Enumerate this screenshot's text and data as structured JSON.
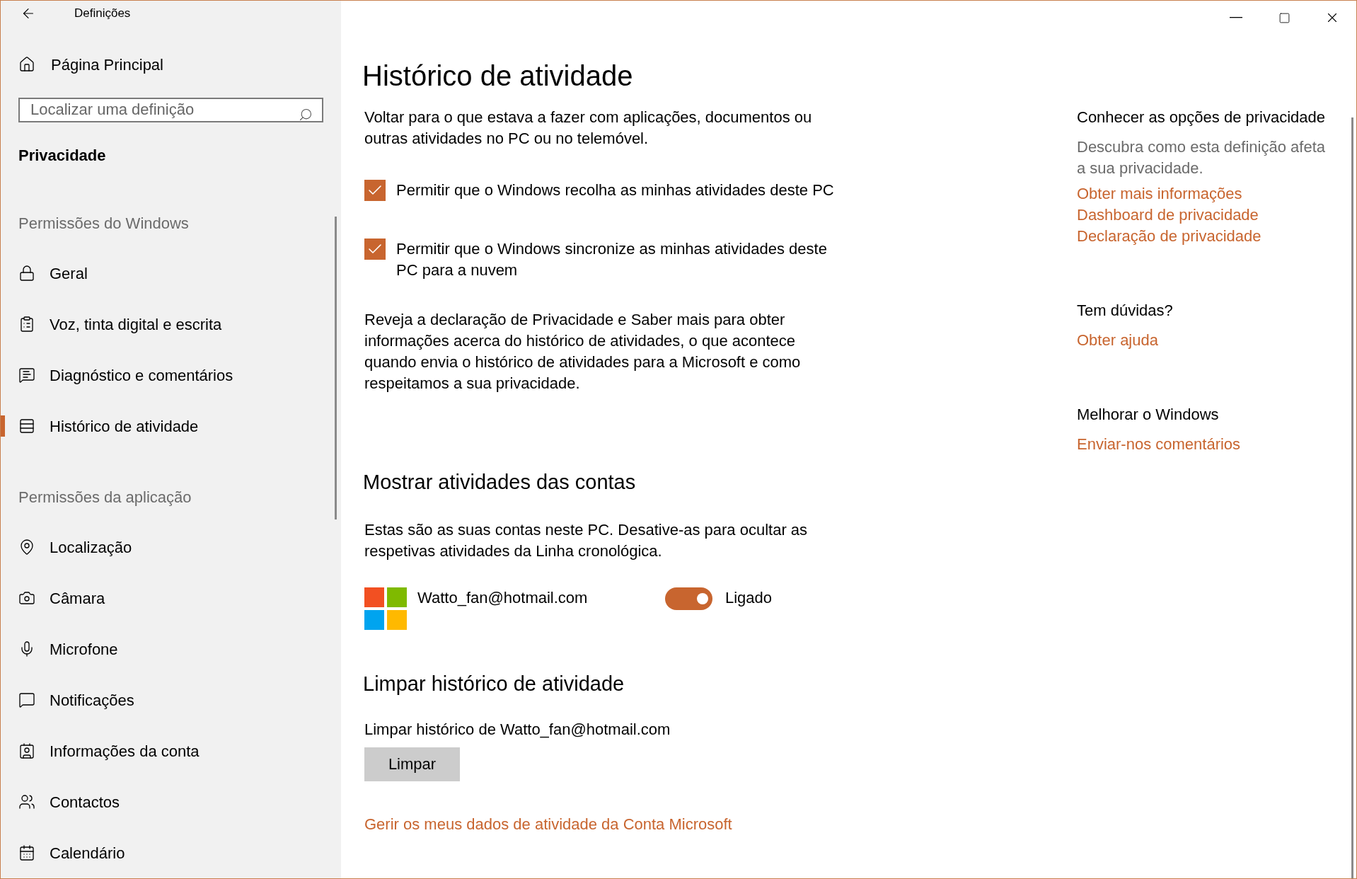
{
  "window": {
    "title": "Definições"
  },
  "sidebar": {
    "home": "Página Principal",
    "search": {
      "placeholder": "Localizar uma definição"
    },
    "category": "Privacidade",
    "groups": [
      {
        "label": "Permissões do Windows",
        "items": [
          {
            "label": "Geral",
            "selected": false
          },
          {
            "label": "Voz, tinta digital e escrita",
            "selected": false
          },
          {
            "label": "Diagnóstico e comentários",
            "selected": false
          },
          {
            "label": "Histórico de atividade",
            "selected": true
          }
        ]
      },
      {
        "label": "Permissões da aplicação",
        "items": [
          {
            "label": "Localização",
            "selected": false
          },
          {
            "label": "Câmara",
            "selected": false
          },
          {
            "label": "Microfone",
            "selected": false
          },
          {
            "label": "Notificações",
            "selected": false
          },
          {
            "label": "Informações da conta",
            "selected": false
          },
          {
            "label": "Contactos",
            "selected": false
          },
          {
            "label": "Calendário",
            "selected": false
          }
        ]
      }
    ]
  },
  "main": {
    "title": "Histórico de atividade",
    "intro": "Voltar para o que estava a fazer com aplicações, documentos ou outras atividades no PC ou no telemóvel.",
    "checkboxes": [
      {
        "label": "Permitir que o Windows recolha as minhas atividades deste PC",
        "checked": true
      },
      {
        "label": "Permitir que o Windows sincronize as minhas atividades deste PC para a nuvem",
        "checked": true
      }
    ],
    "notice": "Reveja a declaração de Privacidade e Saber mais para obter informações acerca do histórico de atividades, o que acontece quando envia o histórico de atividades para a Microsoft e como respeitamos a sua privacidade.",
    "accounts_section": {
      "title": "Mostrar atividades das contas",
      "description": "Estas são as suas contas neste PC. Desative-as para ocultar as respetivas atividades da Linha cronológica.",
      "accounts": [
        {
          "email": "Watto_fan@hotmail.com",
          "on": true,
          "state": "Ligado"
        }
      ]
    },
    "clear_section": {
      "title": "Limpar histórico de atividade",
      "label": "Limpar histórico de Watto_fan@hotmail.com",
      "button": "Limpar"
    },
    "manage_link": "Gerir os meus dados de atividade da Conta Microsoft"
  },
  "aside": [
    {
      "title": "Conhecer as opções de privacidade",
      "description": "Descubra como esta definição afeta a sua privacidade.",
      "links": [
        "Obter mais informações",
        "Dashboard de privacidade",
        "Declaração de privacidade"
      ]
    },
    {
      "title": "Tem dúvidas?",
      "links": [
        "Obter ajuda"
      ]
    },
    {
      "title": "Melhorar o Windows",
      "links": [
        "Enviar-nos comentários"
      ]
    }
  ]
}
